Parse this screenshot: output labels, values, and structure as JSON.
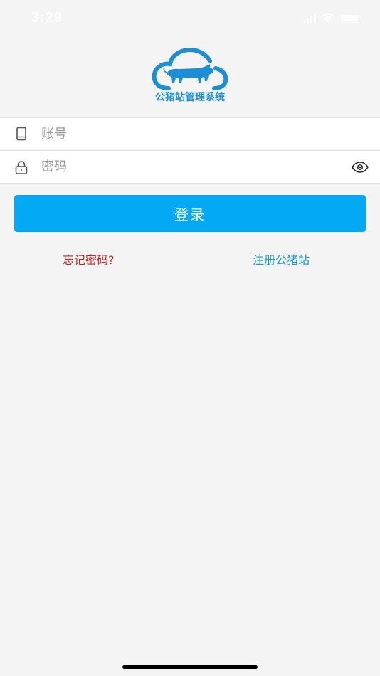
{
  "status_bar": {
    "time": "3:29",
    "signal_icon": "cellular-signal-icon",
    "wifi_icon": "wifi-icon",
    "battery_icon": "battery-icon"
  },
  "logo": {
    "icon": "cloud-pig-logo-icon",
    "text": "公猪站管理系统",
    "color": "#1a8fd6"
  },
  "form": {
    "account": {
      "icon": "phone-icon",
      "placeholder": "账号",
      "value": ""
    },
    "password": {
      "icon": "lock-icon",
      "placeholder": "密码",
      "value": "",
      "toggle_icon": "eye-icon"
    },
    "login_button": "登录",
    "login_color": "#03a9f4"
  },
  "links": {
    "forgot_password": "忘记密码?",
    "forgot_color": "#d0201d",
    "register": "注册公猪站",
    "register_color": "#1a98d5"
  }
}
